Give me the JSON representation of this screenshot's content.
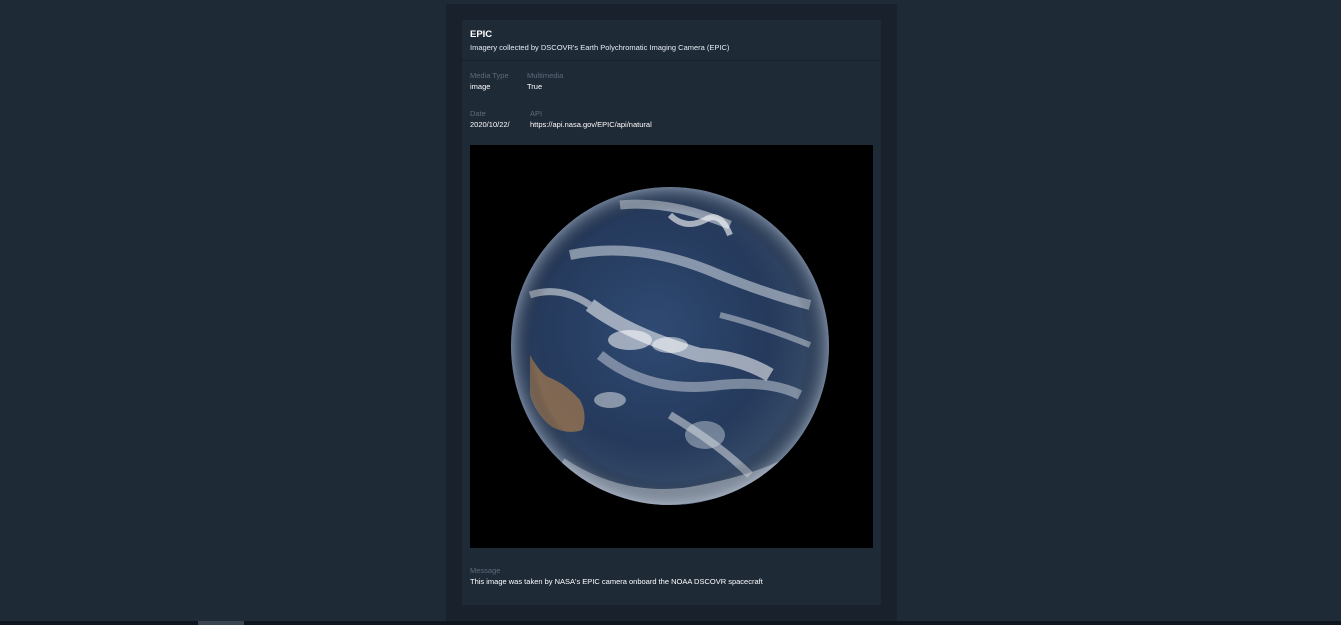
{
  "card": {
    "title": "EPIC",
    "subtitle": "Imagery collected by DSCOVR's Earth Polychromatic Imaging Camera (EPIC)",
    "fields": {
      "media_type": {
        "label": "Media Type",
        "value": "image"
      },
      "multimedia": {
        "label": "Multimedia",
        "value": "True"
      },
      "date": {
        "label": "Date",
        "value": "2020/10/22/"
      },
      "api": {
        "label": "API",
        "value": "https://api.nasa.gov/EPIC/api/natural"
      }
    },
    "message": {
      "label": "Message",
      "value": "This image was taken by NASA's EPIC camera onboard the NOAA DSCOVR spacecraft"
    }
  },
  "colors": {
    "page_background": "#1f2a37",
    "card_outer": "#18212c",
    "card_background": "#1f2a37",
    "label_text": "#5d6b7a",
    "value_text": "#ffffff"
  }
}
